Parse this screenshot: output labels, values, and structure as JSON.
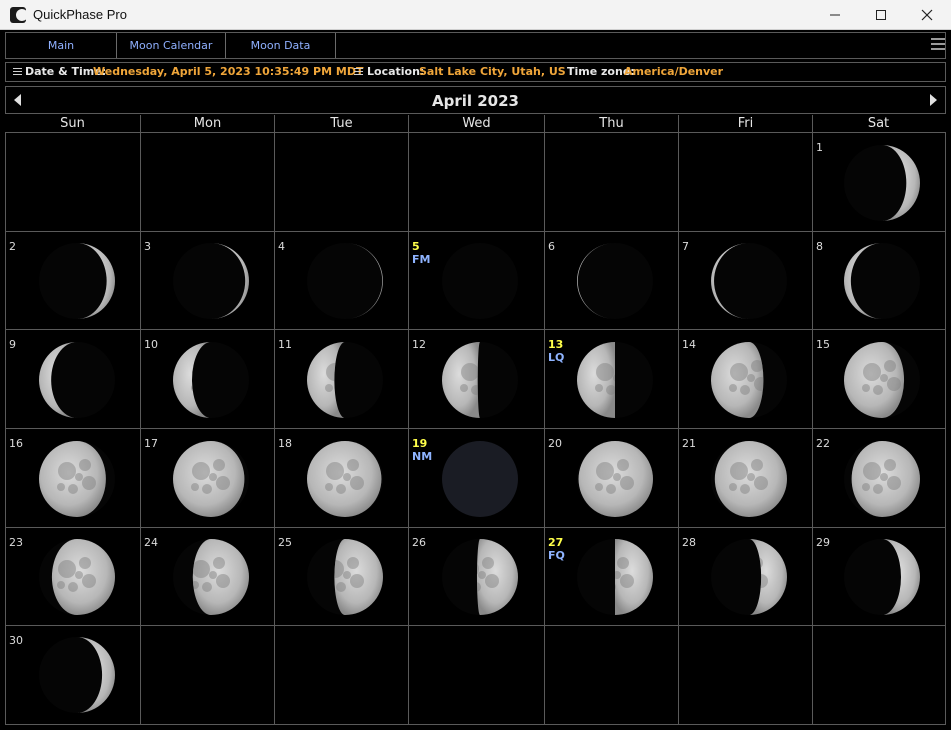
{
  "window": {
    "title": "QuickPhase Pro",
    "app_icon": "moon-icon"
  },
  "tabs": [
    {
      "label": "Main"
    },
    {
      "label": "Moon Calendar"
    },
    {
      "label": "Moon Data"
    }
  ],
  "info": {
    "datetime_label": "Date & Time:",
    "datetime_value": "Wednesday, April 5, 2023  10:35:49 PM MDT",
    "location_label": "Location:",
    "location_value": "Salt Lake City, Utah, US",
    "timezone_label": "Time zone:",
    "timezone_value": "America/Denver"
  },
  "calendar": {
    "title": "April 2023",
    "weekdays": [
      "Sun",
      "Mon",
      "Tue",
      "Wed",
      "Thu",
      "Fri",
      "Sat"
    ],
    "days": [
      {
        "day": "1",
        "frac": 0.82,
        "waxing": true,
        "label": ""
      },
      {
        "day": "2",
        "frac": 0.89,
        "waxing": true,
        "label": ""
      },
      {
        "day": "3",
        "frac": 0.95,
        "waxing": true,
        "label": ""
      },
      {
        "day": "4",
        "frac": 0.99,
        "waxing": true,
        "label": ""
      },
      {
        "day": "5",
        "frac": 1.0,
        "waxing": true,
        "label": "FM"
      },
      {
        "day": "6",
        "frac": 0.99,
        "waxing": false,
        "label": ""
      },
      {
        "day": "7",
        "frac": 0.96,
        "waxing": false,
        "label": ""
      },
      {
        "day": "8",
        "frac": 0.91,
        "waxing": false,
        "label": ""
      },
      {
        "day": "9",
        "frac": 0.84,
        "waxing": false,
        "label": ""
      },
      {
        "day": "10",
        "frac": 0.75,
        "waxing": false,
        "label": ""
      },
      {
        "day": "11",
        "frac": 0.64,
        "waxing": false,
        "label": ""
      },
      {
        "day": "12",
        "frac": 0.53,
        "waxing": false,
        "label": ""
      },
      {
        "day": "13",
        "frac": 0.5,
        "waxing": false,
        "label": "LQ"
      },
      {
        "day": "14",
        "frac": 0.31,
        "waxing": false,
        "label": ""
      },
      {
        "day": "15",
        "frac": 0.21,
        "waxing": false,
        "label": ""
      },
      {
        "day": "16",
        "frac": 0.12,
        "waxing": false,
        "label": ""
      },
      {
        "day": "17",
        "frac": 0.06,
        "waxing": false,
        "label": ""
      },
      {
        "day": "18",
        "frac": 0.02,
        "waxing": false,
        "label": ""
      },
      {
        "day": "19",
        "frac": 0.0,
        "waxing": true,
        "label": "NM"
      },
      {
        "day": "20",
        "frac": 0.02,
        "waxing": true,
        "label": ""
      },
      {
        "day": "21",
        "frac": 0.05,
        "waxing": true,
        "label": ""
      },
      {
        "day": "22",
        "frac": 0.1,
        "waxing": true,
        "label": ""
      },
      {
        "day": "23",
        "frac": 0.17,
        "waxing": true,
        "label": ""
      },
      {
        "day": "24",
        "frac": 0.26,
        "waxing": true,
        "label": ""
      },
      {
        "day": "25",
        "frac": 0.36,
        "waxing": true,
        "label": ""
      },
      {
        "day": "26",
        "frac": 0.46,
        "waxing": true,
        "label": ""
      },
      {
        "day": "27",
        "frac": 0.5,
        "waxing": true,
        "label": "FQ"
      },
      {
        "day": "28",
        "frac": 0.66,
        "waxing": true,
        "label": ""
      },
      {
        "day": "29",
        "frac": 0.75,
        "waxing": true,
        "label": ""
      },
      {
        "day": "30",
        "frac": 0.83,
        "waxing": true,
        "label": ""
      }
    ]
  },
  "colors": {
    "accent": "#f0a63a",
    "tab_text": "#8fb0ff",
    "phase_label": "#8fb4ff",
    "special_day": "#ffff4a"
  },
  "icons": [
    "minimize-icon",
    "maximize-icon",
    "close-icon",
    "hamburger-icon",
    "menu-icon",
    "arrow-left-icon",
    "arrow-right-icon",
    "moon-icon"
  ]
}
